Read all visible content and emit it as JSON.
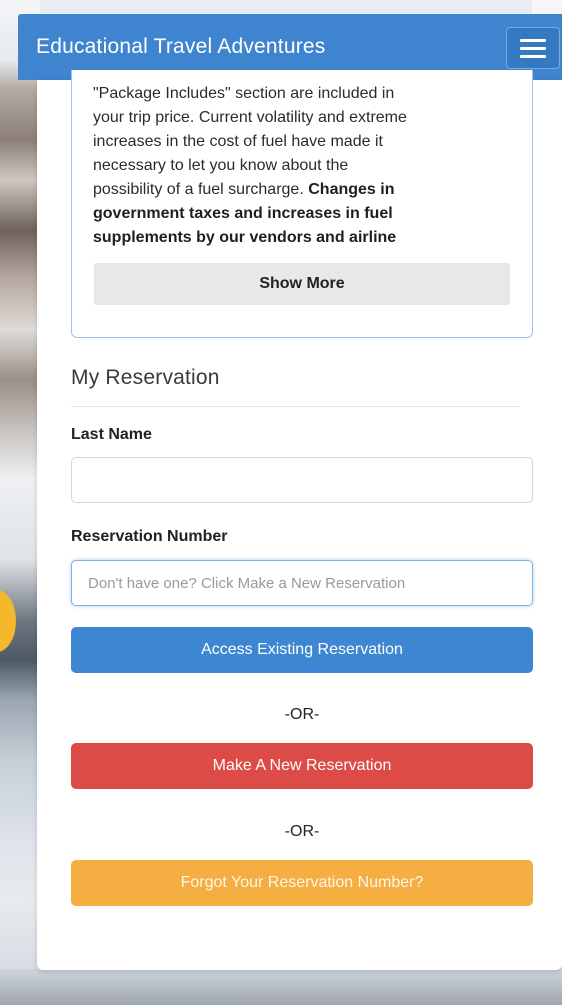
{
  "header": {
    "title": "Educational Travel Adventures",
    "menu_icon": "hamburger-menu-icon"
  },
  "info_box": {
    "line_1": "\"Package Includes\" section are included in",
    "line_2": "your trip price. Current volatility and extreme",
    "line_3": "increases in the cost of fuel have made it",
    "line_4": "necessary to let you know about the",
    "line_5": "possibility of a fuel surcharge.",
    "line_5_bold": "Changes in",
    "line_6_bold": "government taxes and increases in fuel",
    "line_7_bold": "supplements by our vendors and airline",
    "show_more_label": "Show More"
  },
  "reservation": {
    "title": "My Reservation",
    "last_name_label": "Last Name",
    "last_name_value": "",
    "reservation_number_label": "Reservation Number",
    "reservation_number_placeholder": "Don't have one? Click Make a New Reservation",
    "access_label": "Access Existing Reservation",
    "or_label": "-OR-",
    "make_label": "Make A New Reservation",
    "forgot_label": "Forgot Your Reservation Number?"
  },
  "colors": {
    "nav_blue": "#3e84cf",
    "access_blue": "#3d86d2",
    "make_red": "#dc4b45",
    "forgot_orange": "#f4ae42"
  }
}
